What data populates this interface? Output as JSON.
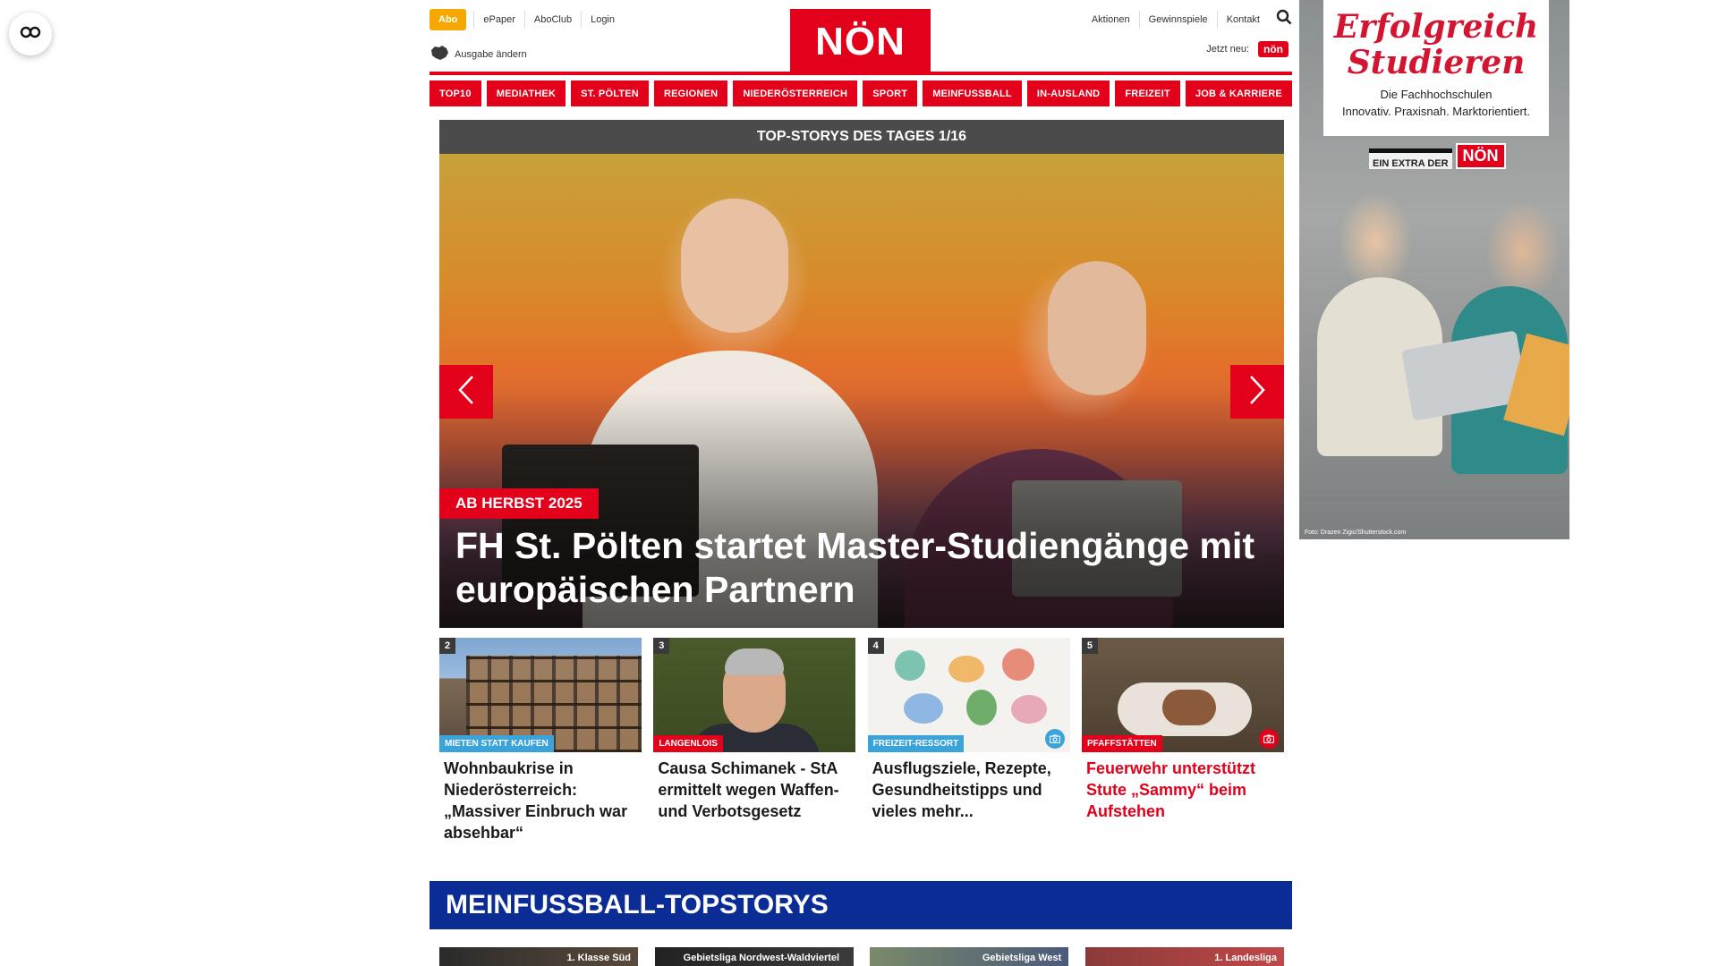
{
  "header": {
    "abo_label": "Abo",
    "top_links": [
      "ePaper",
      "AboClub",
      "Login"
    ],
    "ausgabe_label": "Ausgabe ändern",
    "logo_text": "NÖN",
    "right_links": [
      "Aktionen",
      "Gewinnspiele",
      "Kontakt"
    ],
    "jetzt_neu_label": "Jetzt neu:",
    "jetzt_neu_badge": "nön"
  },
  "nav": {
    "items": [
      "TOP10",
      "MEDIATHEK",
      "ST. PÖLTEN",
      "REGIONEN",
      "NIEDERÖSTERREICH",
      "SPORT",
      "MEINFUSSBALL",
      "IN-AUSLAND",
      "FREIZEIT",
      "JOB & KARRIERE"
    ]
  },
  "hero": {
    "heading": "TOP-STORYS DES TAGES 1/16",
    "kicker": "AB HERBST 2025",
    "title": "FH St. Pölten startet Master-Studiengänge mit europäischen Partnern"
  },
  "stories": [
    {
      "num": "2",
      "tag": "MIETEN STATT KAUFEN",
      "title": "Wohnbaukrise in Niederösterreich: „Massiver Einbruch war absehbar“"
    },
    {
      "num": "3",
      "tag": "LANGENLOIS",
      "title": "Causa Schimanek - StA ermittelt wegen Waffen- und Verbotsgesetz"
    },
    {
      "num": "4",
      "tag": "FREIZEIT-RESSORT",
      "title": "Ausflugsziele, Rezepte, Gesundheitstipps und vieles mehr..."
    },
    {
      "num": "5",
      "tag": "PFAFFSTÄTTEN",
      "title": "Feuerwehr unterstützt Stute „Sammy“ beim Aufstehen"
    }
  ],
  "meinfussball": {
    "heading": "MEINFUSSBALL-TOPSTORYS",
    "leagues": [
      "1. Klasse Süd",
      "Gebietsliga Nordwest-Waldviertel",
      "Gebietsliga West",
      "1. Landesliga"
    ]
  },
  "ad": {
    "title_line1": "Erfolgreich",
    "title_line2": "Studieren",
    "sub_line1": "Die Fachhochschulen",
    "sub_line2": "Innovativ. Praxisnah. Marktorientiert.",
    "extra_label": "EIN EXTRA DER",
    "extra_logo": "NÖN",
    "credit": "Foto: Drazen Zigic/Shutterstock.com"
  },
  "colors": {
    "brand_red": "#e2001a",
    "abo_orange": "#f6a800",
    "meinfussball_blue": "#0b2c95",
    "tag_blue": "#3aa3d9"
  }
}
